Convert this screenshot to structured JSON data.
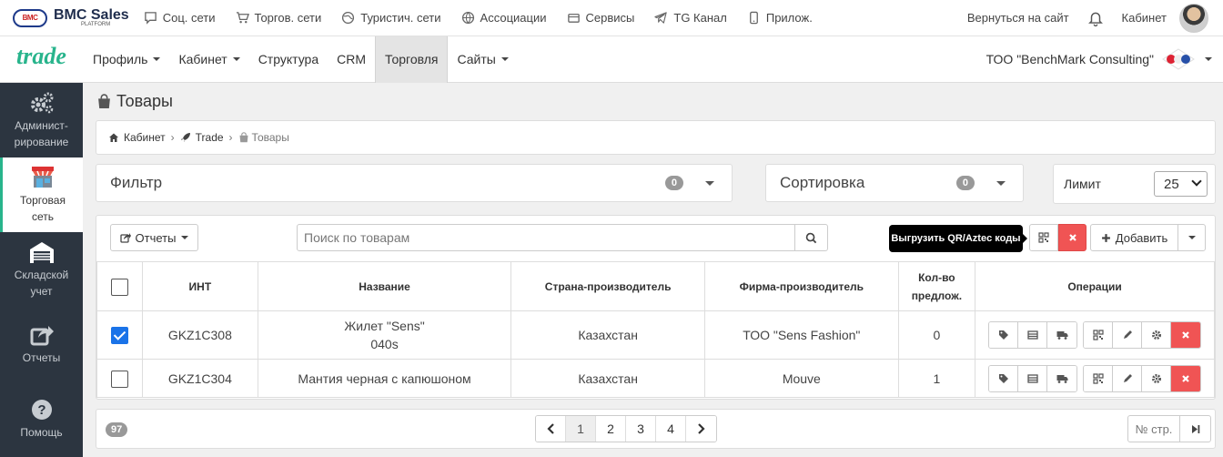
{
  "brand": {
    "name": "BMC Sales",
    "sub": "PLATFORM",
    "logo_text": "BMC"
  },
  "topnav": [
    {
      "label": "Соц. сети",
      "icon": "chat-icon"
    },
    {
      "label": "Торгов. сети",
      "icon": "cart-icon"
    },
    {
      "label": "Туристич. сети",
      "icon": "globe-icon"
    },
    {
      "label": "Ассоциации",
      "icon": "network-globe-icon"
    },
    {
      "label": "Сервисы",
      "icon": "box-icon"
    },
    {
      "label": "TG Канал",
      "icon": "telegram-icon"
    },
    {
      "label": "Прилож.",
      "icon": "mobile-icon"
    }
  ],
  "topright": {
    "back_label": "Вернуться на сайт",
    "cabinet_label": "Кабинет"
  },
  "trade_logo": "trade",
  "secnav": [
    {
      "label": "Профиль",
      "caret": true
    },
    {
      "label": "Кабинет",
      "caret": true
    },
    {
      "label": "Структура",
      "caret": false
    },
    {
      "label": "CRM",
      "caret": false
    },
    {
      "label": "Торговля",
      "caret": false,
      "active": true
    },
    {
      "label": "Сайты",
      "caret": true
    }
  ],
  "company": {
    "name": "ТОО \"BenchMark Consulting\""
  },
  "sidebar": [
    {
      "label": "Админист-рирование",
      "icon": "gears-icon"
    },
    {
      "label": "Торговая сеть",
      "icon": "store-icon",
      "active": true
    },
    {
      "label": "Складской учет",
      "icon": "warehouse-icon"
    },
    {
      "label": "Отчеты",
      "icon": "share-icon"
    },
    {
      "label": "Помощь",
      "icon": "help-icon"
    }
  ],
  "page": {
    "title": "Товары"
  },
  "breadcrumb": {
    "item1": "Кабинет",
    "item2": "Trade",
    "item3": "Товары"
  },
  "filter": {
    "label": "Фильтр",
    "count": "0"
  },
  "sorting": {
    "label": "Сортировка",
    "count": "0"
  },
  "limit": {
    "label": "Лимит",
    "value": "25"
  },
  "toolbar": {
    "reports_label": "Отчеты",
    "search_placeholder": "Поиск по товарам",
    "tooltip": "Выгрузить QR/Aztec коды",
    "add_label": "Добавить"
  },
  "table": {
    "headers": [
      "ИНТ",
      "Название",
      "Страна-производитель",
      "Фирма-производитель",
      "Кол-во предлож.",
      "Операции"
    ],
    "rows": [
      {
        "checked": true,
        "code": "GKZ1C308",
        "name_line1": "Жилет \"Sens\"",
        "name_line2": "040s",
        "country": "Казахстан",
        "firm": "ТОО \"Sens Fashion\"",
        "offers": "0"
      },
      {
        "checked": false,
        "code": "GKZ1C304",
        "name_line1": "Мантия черная с капюшоном",
        "name_line2": "",
        "country": "Казахстан",
        "firm": "Mouve",
        "offers": "1"
      }
    ]
  },
  "pagination": {
    "total": "97",
    "pages": [
      "1",
      "2",
      "3",
      "4"
    ],
    "current": "1",
    "page_input_placeholder": "№ стр."
  },
  "colors": {
    "accent": "#28b48c",
    "sidebar_bg": "#2c3540",
    "danger": "#f05454",
    "checkbox": "#1a73e8"
  }
}
